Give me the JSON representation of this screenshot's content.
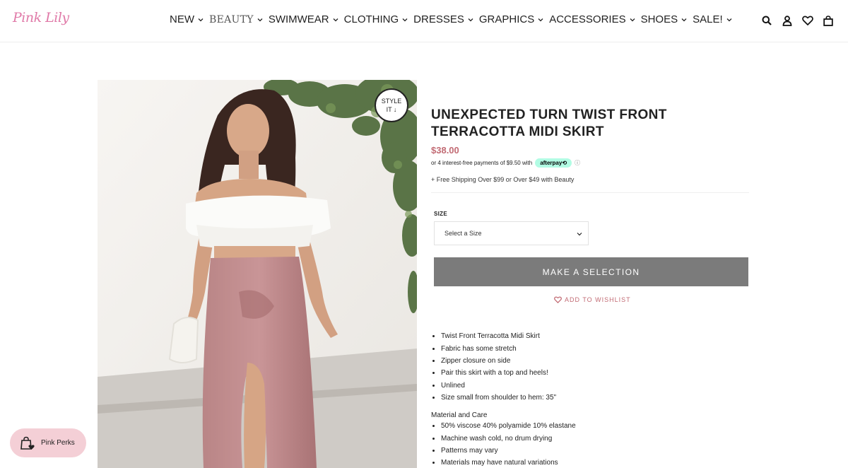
{
  "brand": {
    "logo_text": "Pink Lily"
  },
  "nav": {
    "items": [
      {
        "label": "NEW"
      },
      {
        "label": "BEAUTY"
      },
      {
        "label": "SWIMWEAR"
      },
      {
        "label": "CLOTHING"
      },
      {
        "label": "DRESSES"
      },
      {
        "label": "GRAPHICS"
      },
      {
        "label": "ACCESSORIES"
      },
      {
        "label": "SHOES"
      },
      {
        "label": "SALE!"
      }
    ]
  },
  "header_icons": [
    "search-icon",
    "account-icon",
    "heart-icon",
    "bag-icon"
  ],
  "product": {
    "style_it_line1": "STYLE",
    "style_it_line2": "IT ↓",
    "title": "UNEXPECTED TURN TWIST FRONT TERRACOTTA MIDI SKIRT",
    "price": "$38.00",
    "afterpay_text": "or 4 interest-free payments of $9.50 with",
    "afterpay_badge": "afterpay⟲",
    "afterpay_info": "ⓘ",
    "shipping": "+ Free Shipping Over $99 or Over $49 with Beauty",
    "size_label": "SIZE",
    "size_placeholder": "Select a Size",
    "make_selection": "MAKE A SELECTION",
    "wishlist": "ADD TO WISHLIST",
    "features": [
      "Twist Front Terracotta Midi Skirt",
      "Fabric has some stretch",
      "Zipper closure on side",
      "Pair this skirt with a top and heels!",
      "Unlined",
      "Size small from shoulder to hem: 35\""
    ],
    "care_title": "Material and Care",
    "care": [
      "50% viscose 40% polyamide 10% elastane",
      "Machine wash cold, no drum drying",
      "Patterns may vary",
      "Materials may have natural variations"
    ]
  },
  "perks": {
    "label": "Pink Perks"
  },
  "colors": {
    "accent_pink": "#c26b74",
    "button_gray": "#7b7b7b",
    "perks_bg": "#f4cfd6",
    "afterpay_mint": "#b2fce4"
  }
}
